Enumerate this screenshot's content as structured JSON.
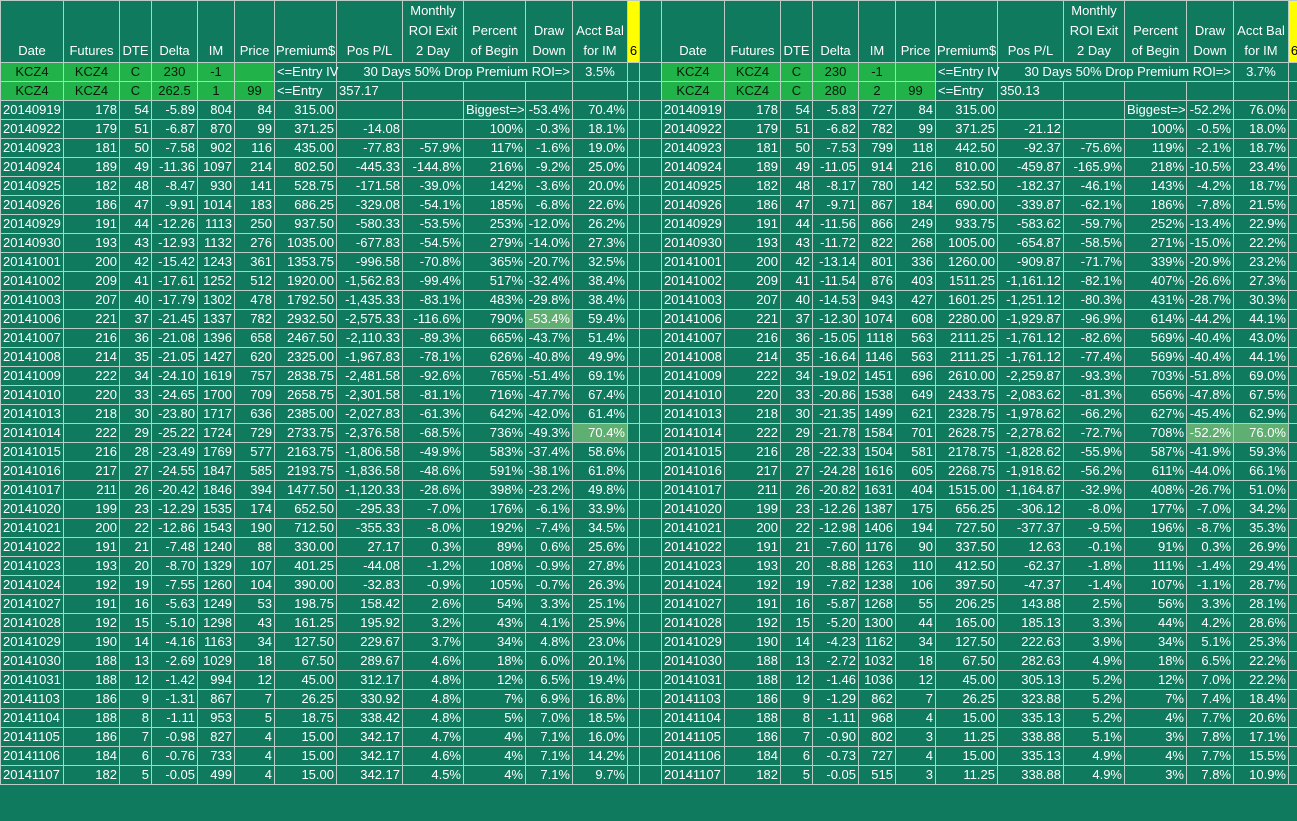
{
  "headers": [
    "Date",
    "Futures",
    "DTE",
    "Delta",
    "IM",
    "Price",
    "Premium$",
    "Pos P/L",
    "Monthly ROI Exit 2 Day",
    "Percent of Begin",
    "Draw Down",
    "Acct Bal for IM",
    "6"
  ],
  "left": {
    "entry1": {
      "a": "KCZ4",
      "b": "KCZ4",
      "c": "C",
      "d": "230",
      "e": "-1",
      "note1": "<=Entry IV",
      "note2": "30 Days 50% Drop Premium ROI=>",
      "roi": "3.5%"
    },
    "entry2": {
      "a": "KCZ4",
      "b": "KCZ4",
      "c": "C",
      "d": "262.5",
      "e": "1",
      "f": "99",
      "note1": "<=Entry",
      "val": "357.17"
    },
    "biggest": {
      "label": "Biggest=>",
      "dd": "-53.4%",
      "bal": "70.4%"
    },
    "rows": [
      [
        "20140919",
        "178",
        "54",
        "-5.89",
        "804",
        "84",
        "315.00",
        "",
        "",
        "",
        "",
        ""
      ],
      [
        "20140922",
        "179",
        "51",
        "-6.87",
        "870",
        "99",
        "371.25",
        "-14.08",
        "",
        "100%",
        "-0.3%",
        "18.1%"
      ],
      [
        "20140923",
        "181",
        "50",
        "-7.58",
        "902",
        "116",
        "435.00",
        "-77.83",
        "-57.9%",
        "117%",
        "-1.6%",
        "19.0%"
      ],
      [
        "20140924",
        "189",
        "49",
        "-11.36",
        "1097",
        "214",
        "802.50",
        "-445.33",
        "-144.8%",
        "216%",
        "-9.2%",
        "25.0%"
      ],
      [
        "20140925",
        "182",
        "48",
        "-8.47",
        "930",
        "141",
        "528.75",
        "-171.58",
        "-39.0%",
        "142%",
        "-3.6%",
        "20.0%"
      ],
      [
        "20140926",
        "186",
        "47",
        "-9.91",
        "1014",
        "183",
        "686.25",
        "-329.08",
        "-54.1%",
        "185%",
        "-6.8%",
        "22.6%"
      ],
      [
        "20140929",
        "191",
        "44",
        "-12.26",
        "1113",
        "250",
        "937.50",
        "-580.33",
        "-53.5%",
        "253%",
        "-12.0%",
        "26.2%"
      ],
      [
        "20140930",
        "193",
        "43",
        "-12.93",
        "1132",
        "276",
        "1035.00",
        "-677.83",
        "-54.5%",
        "279%",
        "-14.0%",
        "27.3%"
      ],
      [
        "20141001",
        "200",
        "42",
        "-15.42",
        "1243",
        "361",
        "1353.75",
        "-996.58",
        "-70.8%",
        "365%",
        "-20.7%",
        "32.5%"
      ],
      [
        "20141002",
        "209",
        "41",
        "-17.61",
        "1252",
        "512",
        "1920.00",
        "-1,562.83",
        "-99.4%",
        "517%",
        "-32.4%",
        "38.4%"
      ],
      [
        "20141003",
        "207",
        "40",
        "-17.79",
        "1302",
        "478",
        "1792.50",
        "-1,435.33",
        "-83.1%",
        "483%",
        "-29.8%",
        "38.4%"
      ],
      [
        "20141006",
        "221",
        "37",
        "-21.45",
        "1337",
        "782",
        "2932.50",
        "-2,575.33",
        "-116.6%",
        "790%",
        "-53.4%",
        "59.4%"
      ],
      [
        "20141007",
        "216",
        "36",
        "-21.08",
        "1396",
        "658",
        "2467.50",
        "-2,110.33",
        "-89.3%",
        "665%",
        "-43.7%",
        "51.4%"
      ],
      [
        "20141008",
        "214",
        "35",
        "-21.05",
        "1427",
        "620",
        "2325.00",
        "-1,967.83",
        "-78.1%",
        "626%",
        "-40.8%",
        "49.9%"
      ],
      [
        "20141009",
        "222",
        "34",
        "-24.10",
        "1619",
        "757",
        "2838.75",
        "-2,481.58",
        "-92.6%",
        "765%",
        "-51.4%",
        "69.1%"
      ],
      [
        "20141010",
        "220",
        "33",
        "-24.65",
        "1700",
        "709",
        "2658.75",
        "-2,301.58",
        "-81.1%",
        "716%",
        "-47.7%",
        "67.4%"
      ],
      [
        "20141013",
        "218",
        "30",
        "-23.80",
        "1717",
        "636",
        "2385.00",
        "-2,027.83",
        "-61.3%",
        "642%",
        "-42.0%",
        "61.4%"
      ],
      [
        "20141014",
        "222",
        "29",
        "-25.22",
        "1724",
        "729",
        "2733.75",
        "-2,376.58",
        "-68.5%",
        "736%",
        "-49.3%",
        "70.4%"
      ],
      [
        "20141015",
        "216",
        "28",
        "-23.49",
        "1769",
        "577",
        "2163.75",
        "-1,806.58",
        "-49.9%",
        "583%",
        "-37.4%",
        "58.6%"
      ],
      [
        "20141016",
        "217",
        "27",
        "-24.55",
        "1847",
        "585",
        "2193.75",
        "-1,836.58",
        "-48.6%",
        "591%",
        "-38.1%",
        "61.8%"
      ],
      [
        "20141017",
        "211",
        "26",
        "-20.42",
        "1846",
        "394",
        "1477.50",
        "-1,120.33",
        "-28.6%",
        "398%",
        "-23.2%",
        "49.8%"
      ],
      [
        "20141020",
        "199",
        "23",
        "-12.29",
        "1535",
        "174",
        "652.50",
        "-295.33",
        "-7.0%",
        "176%",
        "-6.1%",
        "33.9%"
      ],
      [
        "20141021",
        "200",
        "22",
        "-12.86",
        "1543",
        "190",
        "712.50",
        "-355.33",
        "-8.0%",
        "192%",
        "-7.4%",
        "34.5%"
      ],
      [
        "20141022",
        "191",
        "21",
        "-7.48",
        "1240",
        "88",
        "330.00",
        "27.17",
        "0.3%",
        "89%",
        "0.6%",
        "25.6%"
      ],
      [
        "20141023",
        "193",
        "20",
        "-8.70",
        "1329",
        "107",
        "401.25",
        "-44.08",
        "-1.2%",
        "108%",
        "-0.9%",
        "27.8%"
      ],
      [
        "20141024",
        "192",
        "19",
        "-7.55",
        "1260",
        "104",
        "390.00",
        "-32.83",
        "-0.9%",
        "105%",
        "-0.7%",
        "26.3%"
      ],
      [
        "20141027",
        "191",
        "16",
        "-5.63",
        "1249",
        "53",
        "198.75",
        "158.42",
        "2.6%",
        "54%",
        "3.3%",
        "25.1%"
      ],
      [
        "20141028",
        "192",
        "15",
        "-5.10",
        "1298",
        "43",
        "161.25",
        "195.92",
        "3.2%",
        "43%",
        "4.1%",
        "25.9%"
      ],
      [
        "20141029",
        "190",
        "14",
        "-4.16",
        "1163",
        "34",
        "127.50",
        "229.67",
        "3.7%",
        "34%",
        "4.8%",
        "23.0%"
      ],
      [
        "20141030",
        "188",
        "13",
        "-2.69",
        "1029",
        "18",
        "67.50",
        "289.67",
        "4.6%",
        "18%",
        "6.0%",
        "20.1%"
      ],
      [
        "20141031",
        "188",
        "12",
        "-1.42",
        "994",
        "12",
        "45.00",
        "312.17",
        "4.8%",
        "12%",
        "6.5%",
        "19.4%"
      ],
      [
        "20141103",
        "186",
        "9",
        "-1.31",
        "867",
        "7",
        "26.25",
        "330.92",
        "4.8%",
        "7%",
        "6.9%",
        "16.8%"
      ],
      [
        "20141104",
        "188",
        "8",
        "-1.11",
        "953",
        "5",
        "18.75",
        "338.42",
        "4.8%",
        "5%",
        "7.0%",
        "18.5%"
      ],
      [
        "20141105",
        "186",
        "7",
        "-0.98",
        "827",
        "4",
        "15.00",
        "342.17",
        "4.7%",
        "4%",
        "7.1%",
        "16.0%"
      ],
      [
        "20141106",
        "184",
        "6",
        "-0.76",
        "733",
        "4",
        "15.00",
        "342.17",
        "4.6%",
        "4%",
        "7.1%",
        "14.2%"
      ],
      [
        "20141107",
        "182",
        "5",
        "-0.05",
        "499",
        "4",
        "15.00",
        "342.17",
        "4.5%",
        "4%",
        "7.1%",
        "9.7%"
      ]
    ]
  },
  "right": {
    "entry1": {
      "a": "KCZ4",
      "b": "KCZ4",
      "c": "C",
      "d": "230",
      "e": "-1",
      "note1": "<=Entry IV",
      "note2": "30 Days 50% Drop Premium ROI=>",
      "roi": "3.7%"
    },
    "entry2": {
      "a": "KCZ4",
      "b": "KCZ4",
      "c": "C",
      "d": "280",
      "e": "2",
      "f": "99",
      "note1": "<=Entry",
      "val": "350.13"
    },
    "biggest": {
      "label": "Biggest=>",
      "dd": "-52.2%",
      "bal": "76.0%"
    },
    "rows": [
      [
        "20140919",
        "178",
        "54",
        "-5.83",
        "727",
        "84",
        "315.00",
        "",
        "",
        "",
        "",
        ""
      ],
      [
        "20140922",
        "179",
        "51",
        "-6.82",
        "782",
        "99",
        "371.25",
        "-21.12",
        "",
        "100%",
        "-0.5%",
        "18.0%"
      ],
      [
        "20140923",
        "181",
        "50",
        "-7.53",
        "799",
        "118",
        "442.50",
        "-92.37",
        "-75.6%",
        "119%",
        "-2.1%",
        "18.7%"
      ],
      [
        "20140924",
        "189",
        "49",
        "-11.05",
        "914",
        "216",
        "810.00",
        "-459.87",
        "-165.9%",
        "218%",
        "-10.5%",
        "23.4%"
      ],
      [
        "20140925",
        "182",
        "48",
        "-8.17",
        "780",
        "142",
        "532.50",
        "-182.37",
        "-46.1%",
        "143%",
        "-4.2%",
        "18.7%"
      ],
      [
        "20140926",
        "186",
        "47",
        "-9.71",
        "867",
        "184",
        "690.00",
        "-339.87",
        "-62.1%",
        "186%",
        "-7.8%",
        "21.5%"
      ],
      [
        "20140929",
        "191",
        "44",
        "-11.56",
        "866",
        "249",
        "933.75",
        "-583.62",
        "-59.7%",
        "252%",
        "-13.4%",
        "22.9%"
      ],
      [
        "20140930",
        "193",
        "43",
        "-11.72",
        "822",
        "268",
        "1005.00",
        "-654.87",
        "-58.5%",
        "271%",
        "-15.0%",
        "22.2%"
      ],
      [
        "20141001",
        "200",
        "42",
        "-13.14",
        "801",
        "336",
        "1260.00",
        "-909.87",
        "-71.7%",
        "339%",
        "-20.9%",
        "23.2%"
      ],
      [
        "20141002",
        "209",
        "41",
        "-11.54",
        "876",
        "403",
        "1511.25",
        "-1,161.12",
        "-82.1%",
        "407%",
        "-26.6%",
        "27.3%"
      ],
      [
        "20141003",
        "207",
        "40",
        "-14.53",
        "943",
        "427",
        "1601.25",
        "-1,251.12",
        "-80.3%",
        "431%",
        "-28.7%",
        "30.3%"
      ],
      [
        "20141006",
        "221",
        "37",
        "-12.30",
        "1074",
        "608",
        "2280.00",
        "-1,929.87",
        "-96.9%",
        "614%",
        "-44.2%",
        "44.1%"
      ],
      [
        "20141007",
        "216",
        "36",
        "-15.05",
        "1118",
        "563",
        "2111.25",
        "-1,761.12",
        "-82.6%",
        "569%",
        "-40.4%",
        "43.0%"
      ],
      [
        "20141008",
        "214",
        "35",
        "-16.64",
        "1146",
        "563",
        "2111.25",
        "-1,761.12",
        "-77.4%",
        "569%",
        "-40.4%",
        "44.1%"
      ],
      [
        "20141009",
        "222",
        "34",
        "-19.02",
        "1451",
        "696",
        "2610.00",
        "-2,259.87",
        "-93.3%",
        "703%",
        "-51.8%",
        "69.0%"
      ],
      [
        "20141010",
        "220",
        "33",
        "-20.86",
        "1538",
        "649",
        "2433.75",
        "-2,083.62",
        "-81.3%",
        "656%",
        "-47.8%",
        "67.5%"
      ],
      [
        "20141013",
        "218",
        "30",
        "-21.35",
        "1499",
        "621",
        "2328.75",
        "-1,978.62",
        "-66.2%",
        "627%",
        "-45.4%",
        "62.9%"
      ],
      [
        "20141014",
        "222",
        "29",
        "-21.78",
        "1584",
        "701",
        "2628.75",
        "-2,278.62",
        "-72.7%",
        "708%",
        "-52.2%",
        "76.0%"
      ],
      [
        "20141015",
        "216",
        "28",
        "-22.33",
        "1504",
        "581",
        "2178.75",
        "-1,828.62",
        "-55.9%",
        "587%",
        "-41.9%",
        "59.3%"
      ],
      [
        "20141016",
        "217",
        "27",
        "-24.28",
        "1616",
        "605",
        "2268.75",
        "-1,918.62",
        "-56.2%",
        "611%",
        "-44.0%",
        "66.1%"
      ],
      [
        "20141017",
        "211",
        "26",
        "-20.82",
        "1631",
        "404",
        "1515.00",
        "-1,164.87",
        "-32.9%",
        "408%",
        "-26.7%",
        "51.0%"
      ],
      [
        "20141020",
        "199",
        "23",
        "-12.26",
        "1387",
        "175",
        "656.25",
        "-306.12",
        "-8.0%",
        "177%",
        "-7.0%",
        "34.2%"
      ],
      [
        "20141021",
        "200",
        "22",
        "-12.98",
        "1406",
        "194",
        "727.50",
        "-377.37",
        "-9.5%",
        "196%",
        "-8.7%",
        "35.3%"
      ],
      [
        "20141022",
        "191",
        "21",
        "-7.60",
        "1176",
        "90",
        "337.50",
        "12.63",
        "-0.1%",
        "91%",
        "0.3%",
        "26.9%"
      ],
      [
        "20141023",
        "193",
        "20",
        "-8.88",
        "1263",
        "110",
        "412.50",
        "-62.37",
        "-1.8%",
        "111%",
        "-1.4%",
        "29.4%"
      ],
      [
        "20141024",
        "192",
        "19",
        "-7.82",
        "1238",
        "106",
        "397.50",
        "-47.37",
        "-1.4%",
        "107%",
        "-1.1%",
        "28.7%"
      ],
      [
        "20141027",
        "191",
        "16",
        "-5.87",
        "1268",
        "55",
        "206.25",
        "143.88",
        "2.5%",
        "56%",
        "3.3%",
        "28.1%"
      ],
      [
        "20141028",
        "192",
        "15",
        "-5.20",
        "1300",
        "44",
        "165.00",
        "185.13",
        "3.3%",
        "44%",
        "4.2%",
        "28.6%"
      ],
      [
        "20141029",
        "190",
        "14",
        "-4.23",
        "1162",
        "34",
        "127.50",
        "222.63",
        "3.9%",
        "34%",
        "5.1%",
        "25.3%"
      ],
      [
        "20141030",
        "188",
        "13",
        "-2.72",
        "1032",
        "18",
        "67.50",
        "282.63",
        "4.9%",
        "18%",
        "6.5%",
        "22.2%"
      ],
      [
        "20141031",
        "188",
        "12",
        "-1.46",
        "1036",
        "12",
        "45.00",
        "305.13",
        "5.2%",
        "12%",
        "7.0%",
        "22.2%"
      ],
      [
        "20141103",
        "186",
        "9",
        "-1.29",
        "862",
        "7",
        "26.25",
        "323.88",
        "5.2%",
        "7%",
        "7.4%",
        "18.4%"
      ],
      [
        "20141104",
        "188",
        "8",
        "-1.11",
        "968",
        "4",
        "15.00",
        "335.13",
        "5.2%",
        "4%",
        "7.7%",
        "20.6%"
      ],
      [
        "20141105",
        "186",
        "7",
        "-0.90",
        "802",
        "3",
        "11.25",
        "338.88",
        "5.1%",
        "3%",
        "7.8%",
        "17.1%"
      ],
      [
        "20141106",
        "184",
        "6",
        "-0.73",
        "727",
        "4",
        "15.00",
        "335.13",
        "4.9%",
        "4%",
        "7.7%",
        "15.5%"
      ],
      [
        "20141107",
        "182",
        "5",
        "-0.05",
        "515",
        "3",
        "11.25",
        "338.88",
        "4.9%",
        "3%",
        "7.8%",
        "10.9%"
      ]
    ]
  }
}
